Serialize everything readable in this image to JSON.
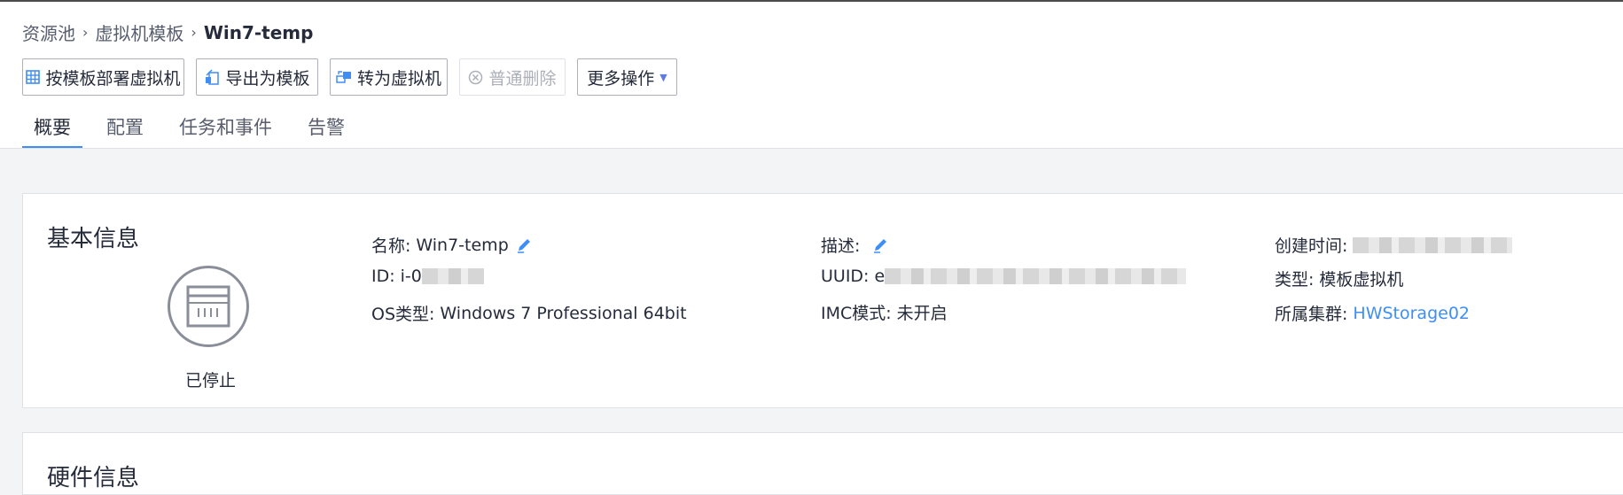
{
  "breadcrumb": {
    "item1": "资源池",
    "item2": "虚拟机模板",
    "current": "Win7-temp",
    "separator": "›"
  },
  "toolbar": {
    "deploy_label": "按模板部署虚拟机",
    "export_label": "导出为模板",
    "convert_label": "转为虚拟机",
    "delete_label": "普通删除",
    "more_label": "更多操作"
  },
  "tabs": [
    {
      "label": "概要",
      "active": true
    },
    {
      "label": "配置",
      "active": false
    },
    {
      "label": "任务和事件",
      "active": false
    },
    {
      "label": "告警",
      "active": false
    }
  ],
  "basic_info": {
    "title": "基本信息",
    "status": "已停止",
    "name_label": "名称:",
    "name_value": "Win7-temp",
    "id_label": "ID:",
    "id_value": "i-0",
    "os_label": "OS类型:",
    "os_value": "Windows 7 Professional 64bit",
    "desc_label": "描述:",
    "uuid_label": "UUID:",
    "uuid_value": "e",
    "imc_label": "IMC模式:",
    "imc_value": "未开启",
    "created_label": "创建时间:",
    "type_label": "类型:",
    "type_value": "模板虚拟机",
    "cluster_label": "所属集群:",
    "cluster_value": "HWStorage02"
  },
  "hardware_info": {
    "title": "硬件信息"
  },
  "colors": {
    "accent": "#3e8ef7",
    "border": "#adb0b8",
    "text": "#252b3a",
    "background": "#f3f4f6"
  }
}
